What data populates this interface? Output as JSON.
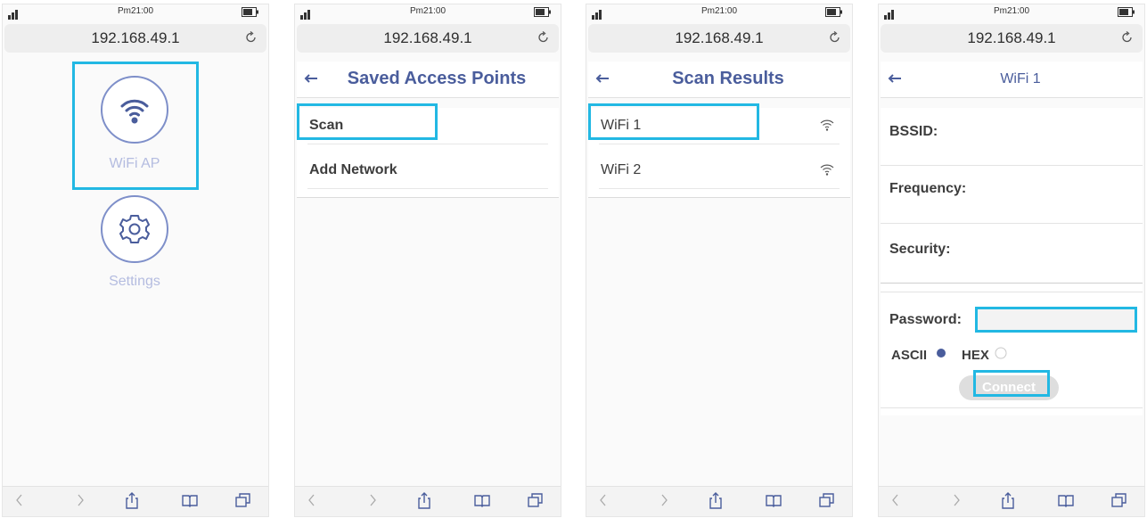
{
  "status_bar": {
    "time": "Pm21:00"
  },
  "browser": {
    "url": "192.168.49.1"
  },
  "panel1": {
    "items": [
      {
        "label": "WiFi AP",
        "icon": "wifi-icon"
      },
      {
        "label": "Settings",
        "icon": "gear-icon"
      }
    ]
  },
  "panel2": {
    "title": "Saved Access Points",
    "items": [
      {
        "label": "Scan"
      },
      {
        "label": "Add Network"
      }
    ]
  },
  "panel3": {
    "title": "Scan Results",
    "items": [
      {
        "label": "WiFi 1"
      },
      {
        "label": "WiFi 2"
      }
    ]
  },
  "panel4": {
    "title": "WiFi 1",
    "bssid_label": "BSSID:",
    "frequency_label": "Frequency:",
    "security_label": "Security:",
    "password_label": "Password:",
    "password_value": "",
    "ascii_label": "ASCII",
    "hex_label": "HEX",
    "selected_encoding": "ASCII",
    "connect_label": "Connect"
  },
  "colors": {
    "highlight": "#22b8e3",
    "accent": "#4a5d9c",
    "icon_ring": "#7e8fc9"
  }
}
